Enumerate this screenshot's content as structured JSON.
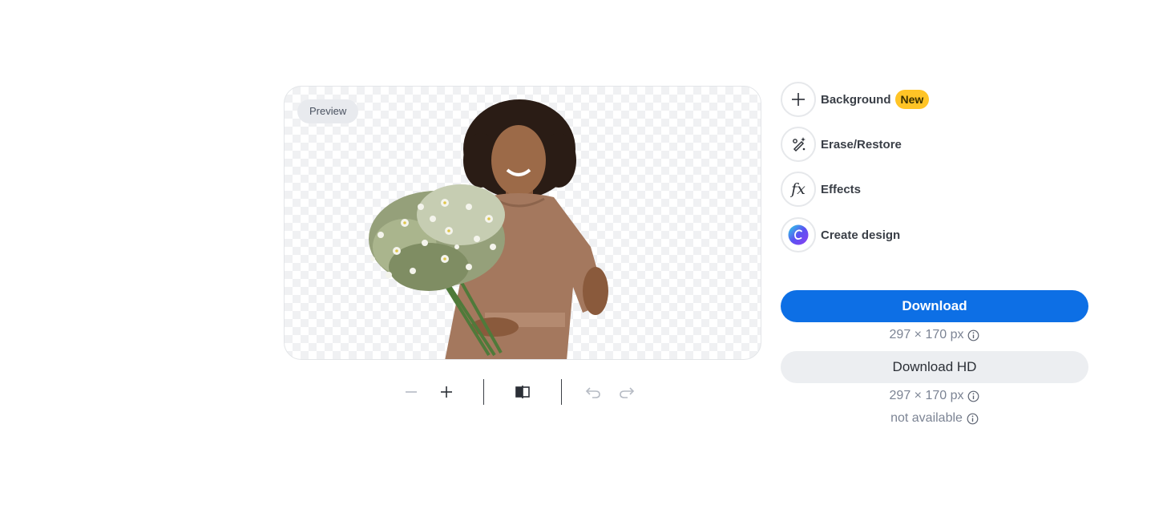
{
  "preview": {
    "badge": "Preview"
  },
  "tools": [
    {
      "label": "Background",
      "icon": "plus-icon",
      "badge": "New"
    },
    {
      "label": "Erase/Restore",
      "icon": "erase-restore-icon"
    },
    {
      "label": "Effects",
      "icon": "fx-icon",
      "glyph": "fx"
    },
    {
      "label": "Create design",
      "icon": "canva-logo-icon"
    }
  ],
  "toolbar": {
    "zoom_out_icon": "minus-icon",
    "zoom_in_icon": "plus-icon",
    "compare_icon": "compare-icon",
    "undo_icon": "undo-icon",
    "redo_icon": "redo-icon"
  },
  "download": {
    "label": "Download",
    "size": "297 × 170 px"
  },
  "download_hd": {
    "label": "Download HD",
    "size": "297 × 170 px",
    "status": "not available"
  },
  "colors": {
    "primary": "#0d6fe5",
    "badge_new": "#ffc426"
  }
}
